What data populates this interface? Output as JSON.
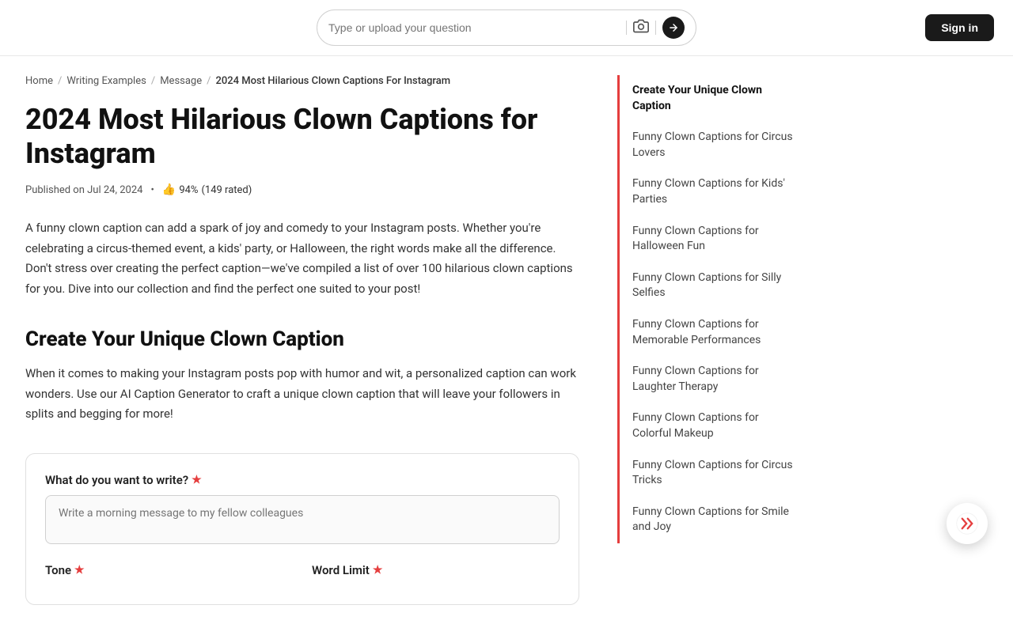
{
  "header": {
    "search_placeholder": "Type or upload your question",
    "sign_in_label": "Sign in"
  },
  "breadcrumb": {
    "items": [
      {
        "label": "Home",
        "href": "#"
      },
      {
        "label": "Writing Examples",
        "href": "#"
      },
      {
        "label": "Message",
        "href": "#"
      },
      {
        "label": "2024 Most Hilarious Clown Captions For Instagram",
        "href": "#"
      }
    ]
  },
  "article": {
    "title": "2024 Most Hilarious Clown Captions for Instagram",
    "published": "Published on Jul 24, 2024",
    "rating_percent": "94%",
    "rating_count": "(149 rated)",
    "body": "A funny clown caption can add a spark of joy and comedy to your Instagram posts. Whether you're celebrating a circus-themed event, a kids' party, or Halloween, the right words make all the difference. Don't stress over creating the perfect caption—we've compiled a list of over 100 hilarious clown captions for you. Dive into our collection and find the perfect one suited to your post!",
    "section_title": "Create Your Unique Clown Caption",
    "section_body": "When it comes to making your Instagram posts pop with humor and wit, a personalized caption can work wonders. Use our AI Caption Generator to craft a unique clown caption that will leave your followers in splits and begging for more!",
    "generator": {
      "field_label": "What do you want to write?",
      "placeholder": "Write a morning message to my fellow colleagues",
      "tone_label": "Tone",
      "word_limit_label": "Word Limit"
    }
  },
  "sidebar": {
    "items": [
      {
        "label": "Create Your Unique Clown Caption",
        "active": true
      },
      {
        "label": "Funny Clown Captions for Circus Lovers",
        "active": false
      },
      {
        "label": "Funny Clown Captions for Kids' Parties",
        "active": false
      },
      {
        "label": "Funny Clown Captions for Halloween Fun",
        "active": false
      },
      {
        "label": "Funny Clown Captions for Silly Selfies",
        "active": false
      },
      {
        "label": "Funny Clown Captions for Memorable Performances",
        "active": false
      },
      {
        "label": "Funny Clown Captions for Laughter Therapy",
        "active": false
      },
      {
        "label": "Funny Clown Captions for Colorful Makeup",
        "active": false
      },
      {
        "label": "Funny Clown Captions for Circus Tricks",
        "active": false
      },
      {
        "label": "Funny Clown Captions for Smile and Joy",
        "active": false
      }
    ]
  }
}
